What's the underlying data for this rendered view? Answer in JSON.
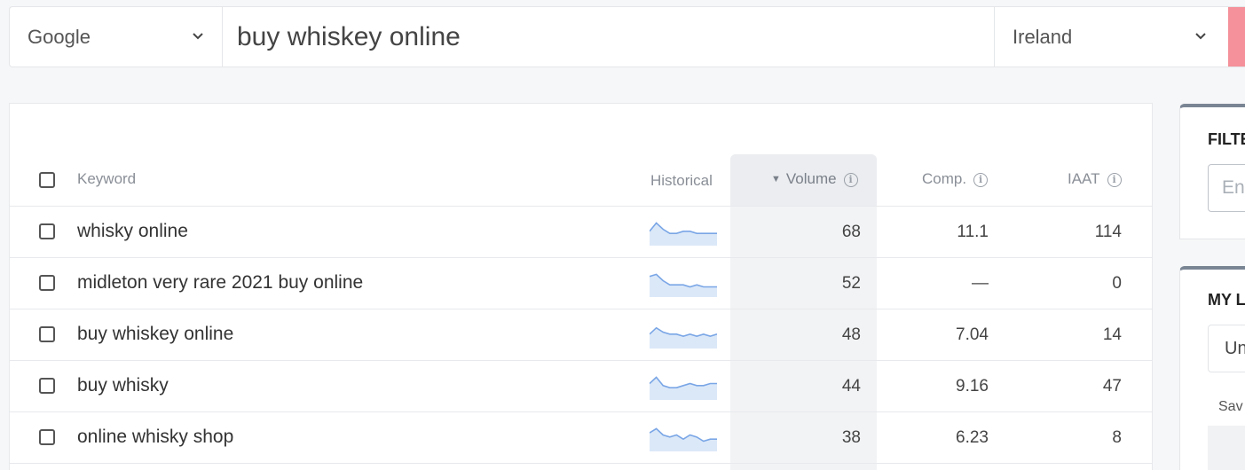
{
  "search": {
    "engine": "Google",
    "query": "buy whiskey online",
    "country": "Ireland"
  },
  "table": {
    "headers": {
      "keyword": "Keyword",
      "historical": "Historical",
      "volume": "Volume",
      "comp": "Comp.",
      "iaat": "IAAT"
    },
    "sort_column": "volume",
    "rows": [
      {
        "keyword": "whisky online",
        "volume": "68",
        "comp": "11.1",
        "iaat": "114",
        "trend": [
          6,
          10,
          7,
          5,
          5,
          6,
          6,
          5,
          5,
          5,
          5
        ]
      },
      {
        "keyword": "midleton very rare 2021 buy online",
        "volume": "52",
        "comp": "—",
        "iaat": "0",
        "trend": [
          9,
          10,
          7,
          5,
          5,
          5,
          4,
          5,
          4,
          4,
          4
        ]
      },
      {
        "keyword": "buy whiskey online",
        "volume": "48",
        "comp": "7.04",
        "iaat": "14",
        "trend": [
          6,
          9,
          7,
          6,
          6,
          5,
          6,
          5,
          6,
          5,
          6
        ]
      },
      {
        "keyword": "buy whisky",
        "volume": "44",
        "comp": "9.16",
        "iaat": "47",
        "trend": [
          7,
          10,
          6,
          5,
          5,
          6,
          7,
          6,
          6,
          7,
          7
        ]
      },
      {
        "keyword": "online whisky shop",
        "volume": "38",
        "comp": "6.23",
        "iaat": "8",
        "trend": [
          8,
          10,
          7,
          6,
          7,
          5,
          7,
          6,
          4,
          5,
          5
        ]
      }
    ]
  },
  "filters_panel": {
    "title": "FILTE",
    "input_placeholder": "En"
  },
  "lists_panel": {
    "title": "MY L",
    "select_value": "Un",
    "save_label": "Sav"
  },
  "colors": {
    "accent_button": "#f4919a",
    "sparkline_stroke": "#7aa6e6",
    "sparkline_fill": "#dbe8f8"
  }
}
